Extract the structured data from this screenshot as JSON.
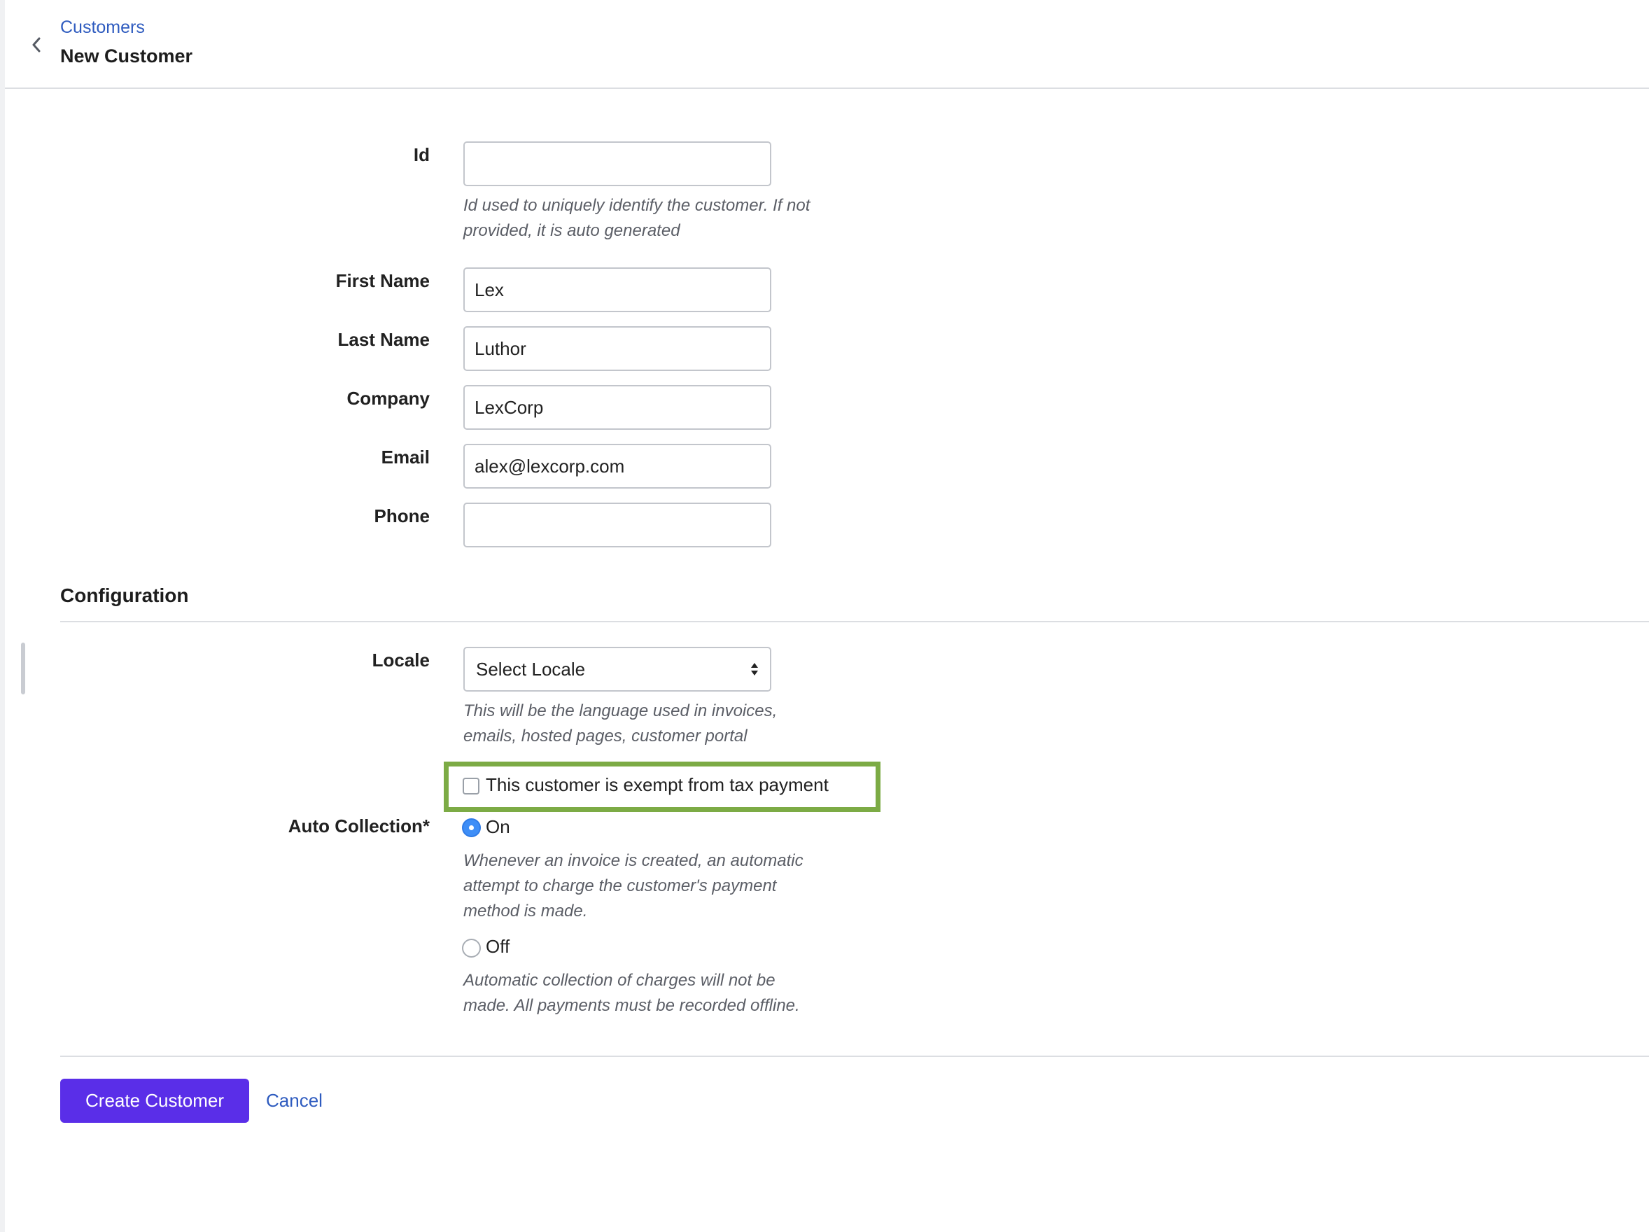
{
  "header": {
    "breadcrumb": "Customers",
    "title": "New Customer",
    "back_icon": "chevron-left-icon"
  },
  "form": {
    "id": {
      "label": "Id",
      "value": "",
      "hint_line1": "Id used to uniquely identify the customer. If not",
      "hint_line2": "provided, it is auto generated"
    },
    "first_name": {
      "label": "First Name",
      "value": "Lex"
    },
    "last_name": {
      "label": "Last Name",
      "value": "Luthor"
    },
    "company": {
      "label": "Company",
      "value": "LexCorp"
    },
    "email": {
      "label": "Email",
      "value": "alex@lexcorp.com"
    },
    "phone": {
      "label": "Phone",
      "value": ""
    }
  },
  "configuration": {
    "title": "Configuration",
    "locale": {
      "label": "Locale",
      "selected": "Select Locale",
      "hint_line1": "This will be the language used in invoices,",
      "hint_line2": "emails, hosted pages, customer portal"
    },
    "tax_exempt": {
      "label": "This customer is exempt from tax payment",
      "checked": false
    },
    "auto_collection": {
      "label": "Auto Collection*",
      "selected": "On",
      "on": {
        "label": "On",
        "hint_line1": "Whenever an invoice is created, an automatic",
        "hint_line2": "attempt to charge the customer's payment",
        "hint_line3": "method is made."
      },
      "off": {
        "label": "Off",
        "hint_line1": "Automatic collection of charges will not be",
        "hint_line2": "made. All payments must be recorded offline."
      }
    }
  },
  "actions": {
    "create_label": "Create Customer",
    "cancel_label": "Cancel"
  },
  "colors": {
    "primary": "#5a2ee8",
    "link": "#2e5bbf",
    "highlight": "#7cab45",
    "radio_selected": "#3e8ef7"
  }
}
